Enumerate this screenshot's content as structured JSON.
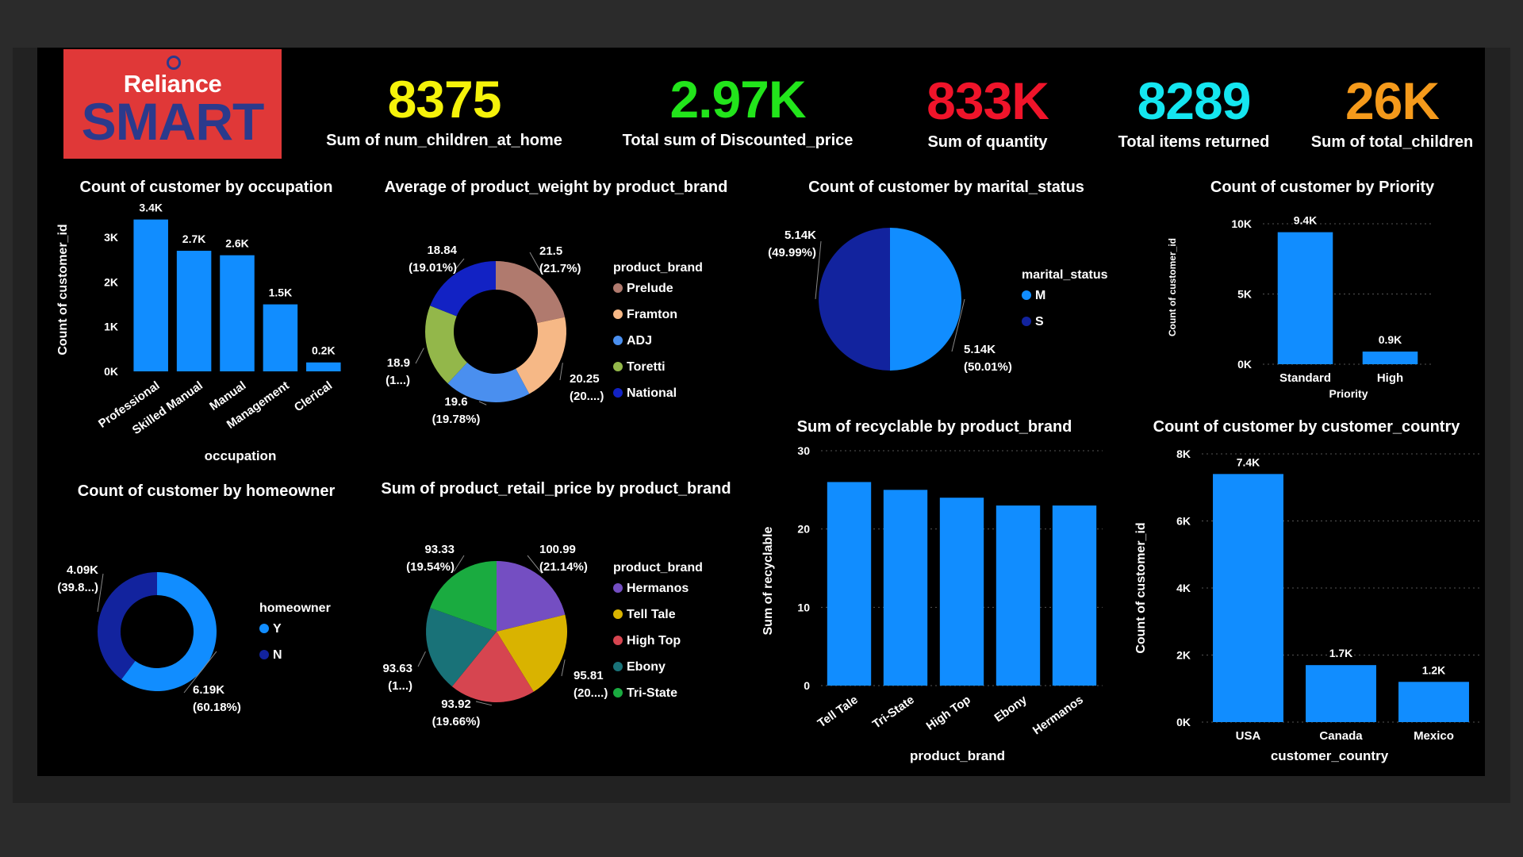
{
  "logo": {
    "line1": "Reliance",
    "line2": "SMART"
  },
  "kpis": [
    {
      "value": "8375",
      "label": "Sum of num_children_at_home",
      "color": "#f5f20a"
    },
    {
      "value": "2.97K",
      "label": "Total sum of Discounted_price",
      "color": "#22e51b"
    },
    {
      "value": "833K",
      "label": "Sum of quantity",
      "color": "#f0142a"
    },
    {
      "value": "8289",
      "label": "Total items returned",
      "color": "#14e6f0"
    },
    {
      "value": "26K",
      "label": "Sum of total_children",
      "color": "#f59a1b"
    }
  ],
  "chart_data": [
    {
      "id": "occupation",
      "type": "bar",
      "title": "Count of customer by occupation",
      "xlabel": "occupation",
      "ylabel": "Count of customer_id",
      "categories": [
        "Professional",
        "Skilled Manual",
        "Manual",
        "Management",
        "Clerical"
      ],
      "values": [
        3400,
        2700,
        2600,
        1500,
        200
      ],
      "data_labels": [
        "3.4K",
        "2.7K",
        "2.6K",
        "1.5K",
        "0.2K"
      ],
      "yticks": [
        0,
        1000,
        2000,
        3000
      ],
      "ytick_labels": [
        "0K",
        "1K",
        "2K",
        "3K"
      ],
      "ylim": [
        0,
        3500
      ],
      "color": "#118dff"
    },
    {
      "id": "weight",
      "type": "pie",
      "donut": true,
      "title": "Average of product_weight by product_brand",
      "legend_title": "product_brand",
      "labels": [
        "Prelude",
        "Framton",
        "ADJ",
        "Toretti",
        "National"
      ],
      "values": [
        21.5,
        20.25,
        19.6,
        18.9,
        18.84
      ],
      "value_labels": [
        "21.5",
        "20.25",
        "19.6",
        "18.9",
        "18.84"
      ],
      "pct_labels": [
        "(21.7%)",
        "(20....)",
        "(19.78%)",
        "(1...)",
        "(19.01%)"
      ],
      "colors": [
        "#b07a6e",
        "#f6b886",
        "#4a8fef",
        "#93b74a",
        "#1222c4"
      ]
    },
    {
      "id": "marital",
      "type": "pie",
      "title": "Count of customer by marital_status",
      "legend_title": "marital_status",
      "labels": [
        "M",
        "S"
      ],
      "values": [
        5140,
        5140
      ],
      "value_labels": [
        "5.14K",
        "5.14K"
      ],
      "pct_labels": [
        "(50.01%)",
        "(49.99%)"
      ],
      "shares": [
        50.01,
        49.99
      ],
      "colors": [
        "#118dff",
        "#12239e"
      ]
    },
    {
      "id": "priority",
      "type": "bar",
      "title": "Count of customer by Priority",
      "xlabel": "Priority",
      "ylabel": "Count of customer_id",
      "categories": [
        "Standard",
        "High"
      ],
      "values": [
        9400,
        900
      ],
      "data_labels": [
        "9.4K",
        "0.9K"
      ],
      "yticks": [
        0,
        5000,
        10000
      ],
      "ytick_labels": [
        "0K",
        "5K",
        "10K"
      ],
      "ylim": [
        0,
        10000
      ],
      "color": "#118dff"
    },
    {
      "id": "homeowner",
      "type": "pie",
      "donut": true,
      "title": "Count of customer by homeowner",
      "legend_title": "homeowner",
      "labels": [
        "Y",
        "N"
      ],
      "values": [
        6190,
        4090
      ],
      "value_labels": [
        "6.19K",
        "4.09K"
      ],
      "pct_labels": [
        "(60.18%)",
        "(39.8...)"
      ],
      "colors": [
        "#118dff",
        "#12239e"
      ]
    },
    {
      "id": "retail",
      "type": "pie",
      "title": "Sum of product_retail_price by product_brand",
      "legend_title": "product_brand",
      "labels": [
        "Hermanos",
        "Tell Tale",
        "High Top",
        "Ebony",
        "Tri-State"
      ],
      "values": [
        100.99,
        95.81,
        93.92,
        93.63,
        93.33
      ],
      "value_labels": [
        "100.99",
        "95.81",
        "93.92",
        "93.63",
        "93.33"
      ],
      "pct_labels": [
        "(21.14%)",
        "(20....)",
        "(19.66%)",
        "(1...)",
        "(19.54%)"
      ],
      "colors": [
        "#744ec2",
        "#d9b300",
        "#d64550",
        "#197278",
        "#1aab40"
      ]
    },
    {
      "id": "recyclable",
      "type": "bar",
      "title": "Sum of recyclable by product_brand",
      "xlabel": "product_brand",
      "ylabel": "Sum of recyclable",
      "categories": [
        "Tell Tale",
        "Tri-State",
        "High Top",
        "Ebony",
        "Hermanos"
      ],
      "values": [
        26,
        25,
        24,
        23,
        23
      ],
      "yticks": [
        0,
        10,
        20,
        30
      ],
      "ytick_labels": [
        "0",
        "10",
        "20",
        "30"
      ],
      "ylim": [
        0,
        30
      ],
      "color": "#118dff"
    },
    {
      "id": "country",
      "type": "bar",
      "title": "Count of customer by customer_country",
      "xlabel": "customer_country",
      "ylabel": "Count of customer_id",
      "categories": [
        "USA",
        "Canada",
        "Mexico"
      ],
      "values": [
        7400,
        1700,
        1200
      ],
      "data_labels": [
        "7.4K",
        "1.7K",
        "1.2K"
      ],
      "yticks": [
        0,
        2000,
        4000,
        6000,
        8000
      ],
      "ytick_labels": [
        "0K",
        "2K",
        "4K",
        "6K",
        "8K"
      ],
      "ylim": [
        0,
        8000
      ],
      "color": "#118dff"
    }
  ]
}
